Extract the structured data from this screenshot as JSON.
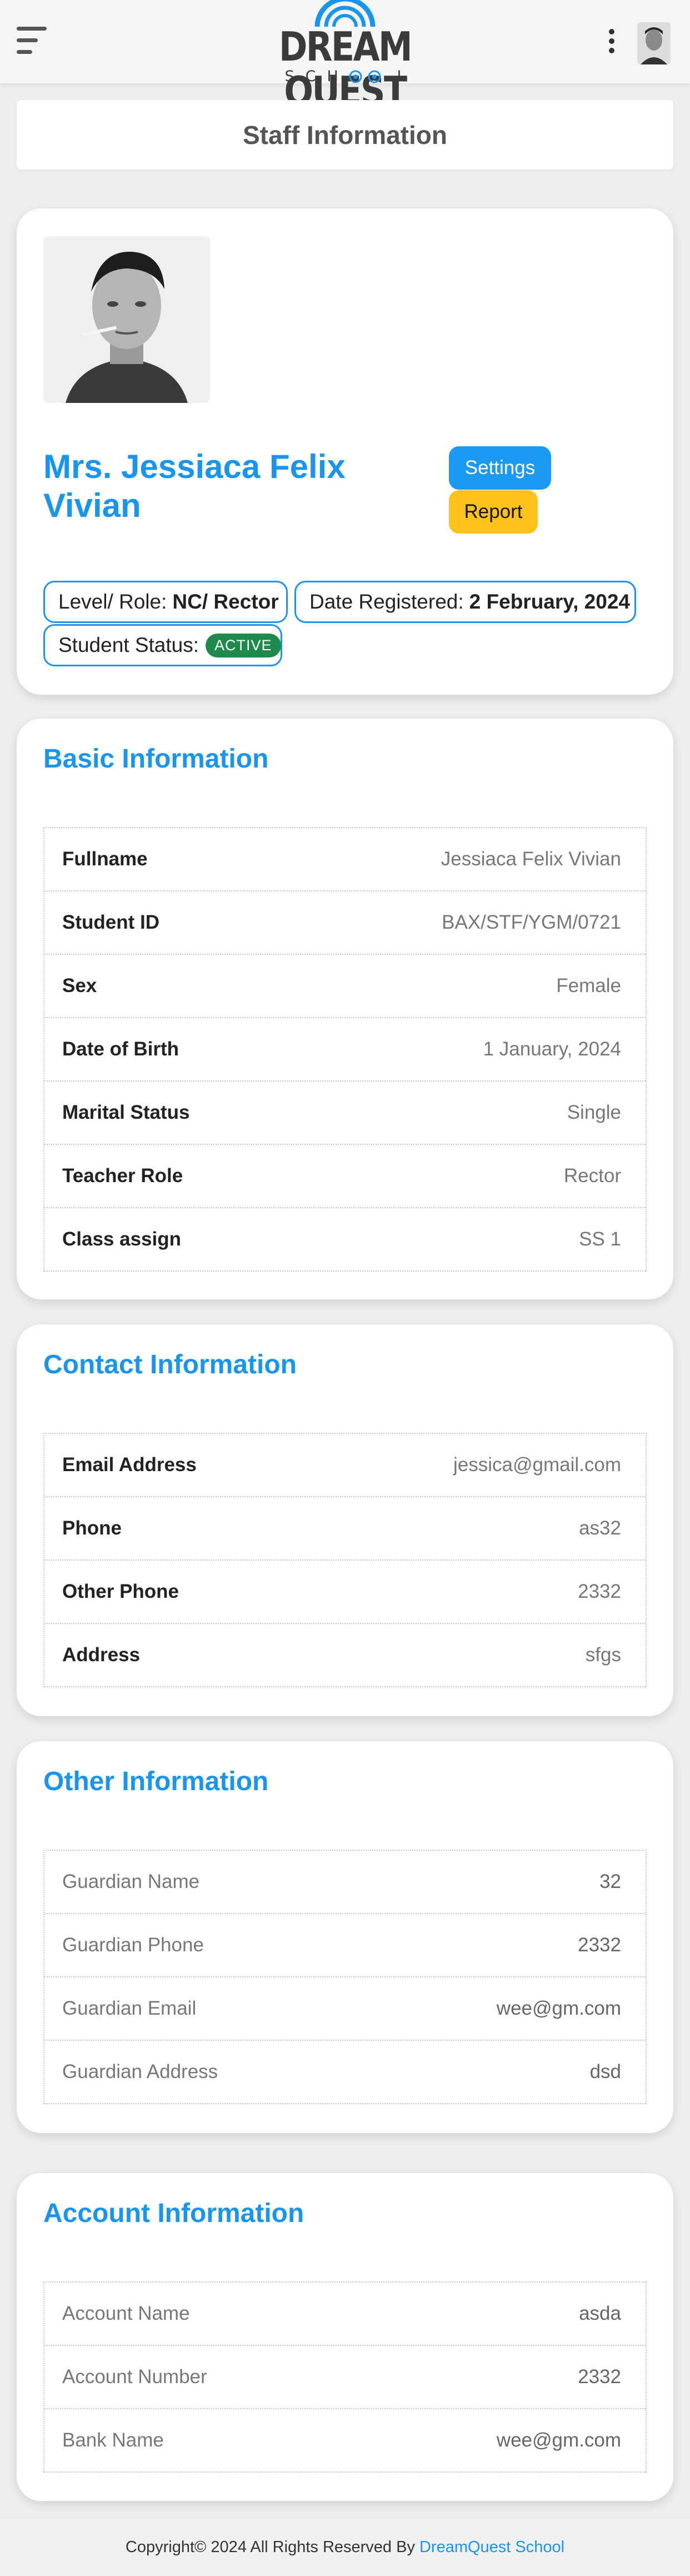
{
  "header": {
    "logo_title": "DREAM QUEST",
    "logo_subtitle": "SCH   L",
    "brand_color": "#1a95ee",
    "menu_icon": "hamburger-icon",
    "more_icon": "kebab-menu-icon"
  },
  "page_title": "Staff Information",
  "profile": {
    "name": "Mrs. Jessiaca Felix Vivian",
    "settings_label": "Settings",
    "report_label": "Report",
    "role_label": "Level/ Role:",
    "role_value": "NC/ Rector",
    "date_label": "Date Registered:",
    "date_value": "2 February, 2024",
    "status_label": "Student Status:",
    "status_value": "ACTIVE"
  },
  "basic": {
    "title": "Basic Information",
    "rows": [
      {
        "label": "Fullname",
        "value": "Jessiaca Felix Vivian"
      },
      {
        "label": "Student ID",
        "value": "BAX/STF/YGM/0721"
      },
      {
        "label": "Sex",
        "value": "Female"
      },
      {
        "label": "Date of Birth",
        "value": "1 January, 2024"
      },
      {
        "label": "Marital Status",
        "value": "Single"
      },
      {
        "label": "Teacher Role",
        "value": "Rector"
      },
      {
        "label": "Class assign",
        "value": "SS 1"
      }
    ]
  },
  "contact": {
    "title": "Contact Information",
    "rows": [
      {
        "label": "Email Address",
        "value": "jessica@gmail.com"
      },
      {
        "label": "Phone",
        "value": "as32"
      },
      {
        "label": "Other Phone",
        "value": "2332"
      },
      {
        "label": "Address",
        "value": "sfgs"
      }
    ]
  },
  "other": {
    "title": "Other Information",
    "rows": [
      {
        "label": "Guardian Name",
        "value": "32"
      },
      {
        "label": "Guardian Phone",
        "value": "2332"
      },
      {
        "label": "Guardian Email",
        "value": "wee@gm.com"
      },
      {
        "label": "Guardian Address",
        "value": "dsd"
      }
    ]
  },
  "account": {
    "title": "Account Information",
    "rows": [
      {
        "label": "Account Name",
        "value": "asda"
      },
      {
        "label": "Account Number",
        "value": "2332"
      },
      {
        "label": "Bank Name",
        "value": "wee@gm.com"
      }
    ]
  },
  "footer": {
    "text": "Copyright© 2024 All Rights Reserved By",
    "link": "DreamQuest School"
  }
}
